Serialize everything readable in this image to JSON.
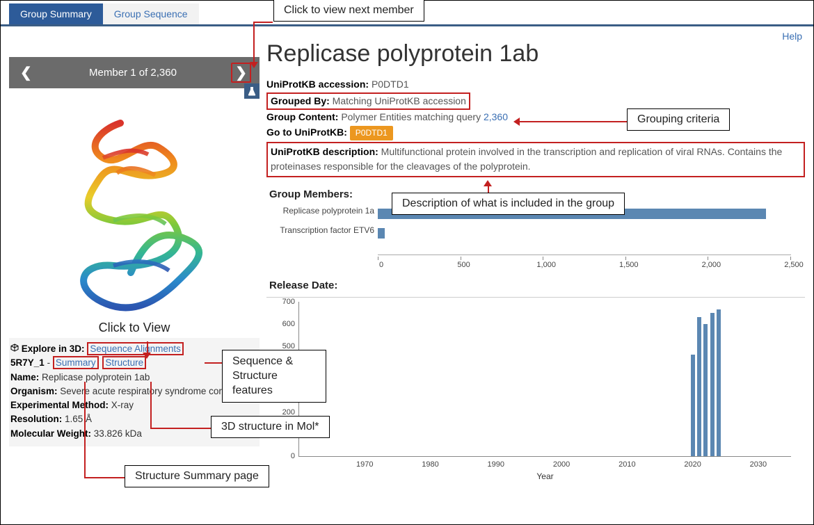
{
  "tabs": {
    "summary": "Group Summary",
    "sequence": "Group Sequence"
  },
  "pager": {
    "text": "Member 1 of 2,360"
  },
  "help_link": "Help",
  "title": "Replicase polyprotein 1ab",
  "meta": {
    "accession_label": "UniProtKB accession:",
    "accession_value": "P0DTD1",
    "grouped_by_label": "Grouped By:",
    "grouped_by_value": "Matching UniProtKB accession",
    "group_content_label": "Group Content:",
    "group_content_value_prefix": "Polymer Entities matching query",
    "group_content_count": "2,360",
    "goto_label": "Go to UniProtKB:",
    "goto_badge": "P0DTD1",
    "desc_label": "UniProtKB description:",
    "desc_value": "Multifunctional protein involved in the transcription and replication of viral RNAs. Contains the proteinases responsible for the cleavages of the polyprotein."
  },
  "left": {
    "click_to_view": "Click to View",
    "explore_label": "Explore in 3D:",
    "seq_align": "Sequence Alignments",
    "entity_id": "5R7Y_1",
    "summary_link": "Summary",
    "structure_link": "Structure",
    "name_label": "Name:",
    "name_value": "Replicase polyprotein 1ab",
    "organism_label": "Organism:",
    "organism_value": "Severe acute respiratory syndrome cor…",
    "method_label": "Experimental Method:",
    "method_value": "X-ray",
    "resolution_label": "Resolution:",
    "resolution_value": "1.65 Å",
    "mw_label": "Molecular Weight:",
    "mw_value": "33.826 kDa"
  },
  "sections": {
    "group_members": "Group Members:",
    "release_date": "Release Date:"
  },
  "chart_data": [
    {
      "type": "bar",
      "title": "Group Members",
      "orientation": "horizontal",
      "categories": [
        "Replicase polyprotein 1a",
        "Transcription factor ETV6"
      ],
      "values": [
        2350,
        40
      ],
      "xlim": [
        0,
        2500
      ],
      "xticks": [
        0,
        500,
        1000,
        1500,
        2000,
        2500
      ]
    },
    {
      "type": "bar",
      "title": "Release Date",
      "xlabel": "Year",
      "ylabel": "",
      "xlim": [
        1960,
        2035
      ],
      "ylim": [
        0,
        700
      ],
      "yticks": [
        0,
        100,
        200,
        300,
        400,
        500,
        600,
        700
      ],
      "xticks": [
        1970,
        1980,
        1990,
        2000,
        2010,
        2020,
        2030
      ],
      "series": [
        {
          "name": "count",
          "x": [
            2020,
            2021,
            2022,
            2023,
            2024
          ],
          "values": [
            460,
            630,
            600,
            650,
            665
          ]
        }
      ]
    }
  ],
  "callouts": {
    "next_member": "Click to view next member",
    "grouping_criteria": "Grouping criteria",
    "group_desc": "Description of what is included in the group",
    "seq_struct": "Sequence & Structure features",
    "molstar": "3D structure in Mol*",
    "summary_page": "Structure Summary page"
  }
}
